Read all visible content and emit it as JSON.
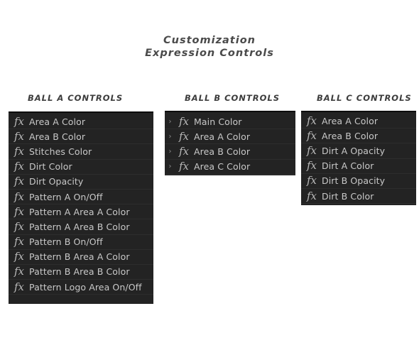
{
  "title": {
    "line1": "Customization",
    "line2": "Expression Controls"
  },
  "icons": {
    "effect": "fx-icon",
    "expander": "chevron-right-icon"
  },
  "colors": {
    "panel_bg": "#232323",
    "label": "#c9c9c9",
    "heading": "#3c3c3c"
  },
  "panels": [
    {
      "heading": "BALL A CONTROLS",
      "items": [
        {
          "fx": "fx",
          "label": "Area A Color"
        },
        {
          "fx": "fx",
          "label": "Area B Color"
        },
        {
          "fx": "fx",
          "label": "Stitches Color"
        },
        {
          "fx": "fx",
          "label": "Dirt Color"
        },
        {
          "fx": "fx",
          "label": "Dirt Opacity"
        },
        {
          "fx": "fx",
          "label": "Pattern A On/Off"
        },
        {
          "fx": "fx",
          "label": "Pattern A Area A Color"
        },
        {
          "fx": "fx",
          "label": "Pattern A Area B Color"
        },
        {
          "fx": "fx",
          "label": "Pattern B On/Off"
        },
        {
          "fx": "fx",
          "label": "Pattern B Area A Color"
        },
        {
          "fx": "fx",
          "label": "Pattern B Area B Color"
        },
        {
          "fx": "fx",
          "label": "Pattern Logo Area On/Off"
        }
      ]
    },
    {
      "heading": "BALL B CONTROLS",
      "items": [
        {
          "chevron": "›",
          "fx": "fx",
          "label": "Main Color"
        },
        {
          "chevron": "›",
          "fx": "fx",
          "label": "Area A Color"
        },
        {
          "chevron": "›",
          "fx": "fx",
          "label": "Area B Color"
        },
        {
          "chevron": "›",
          "fx": "fx",
          "label": "Area C Color"
        }
      ]
    },
    {
      "heading": "BALL C CONTROLS",
      "items": [
        {
          "fx": "fx",
          "label": "Area A Color"
        },
        {
          "fx": "fx",
          "label": "Area B Color"
        },
        {
          "fx": "fx",
          "label": "Dirt A Opacity"
        },
        {
          "fx": "fx",
          "label": "Dirt A Color"
        },
        {
          "fx": "fx",
          "label": "Dirt B Opacity"
        },
        {
          "fx": "fx",
          "label": "Dirt B Color"
        }
      ]
    }
  ]
}
